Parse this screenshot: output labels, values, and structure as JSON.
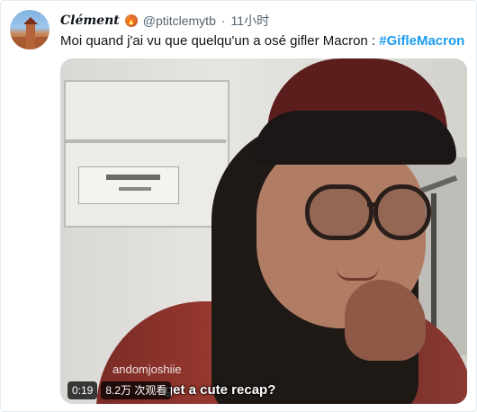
{
  "tweet": {
    "display_name": "Clément",
    "name_emoji": "fire-emoji",
    "handle": "@ptitclemytb",
    "separator": "·",
    "time": "11小时",
    "text": "Moi quand j'ai vu que quelqu'un a osé gifler Macron : ",
    "hashtag": "#GifleMacron"
  },
  "media": {
    "duration": "0:19",
    "views": "8.2万 次观看",
    "caption": "get a cute recap?",
    "watermark": "andomjoshiie"
  },
  "colors": {
    "hashtag": "#1d9bf0",
    "secondary_text": "#536471",
    "primary_text": "#0f1419"
  }
}
